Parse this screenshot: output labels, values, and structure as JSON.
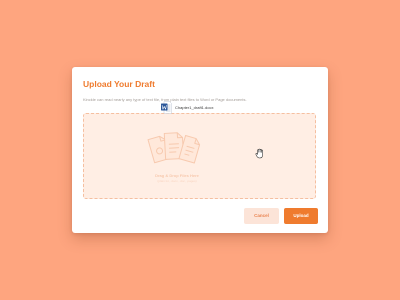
{
  "dialog": {
    "title": "Upload Your Draft",
    "subtitle": "Kinckle can read nearly any type of text file, from plain text files to Word or Page documents."
  },
  "dropzone": {
    "main_text": "Drag & Drop Files Here",
    "hint_text": "(plain txt, .docx, .doc, .pages)"
  },
  "dragged_file": {
    "name": "Chapter1_draft1.docx",
    "icon": "word-doc-icon"
  },
  "buttons": {
    "cancel_label": "Cancel",
    "upload_label": "Upload"
  },
  "colors": {
    "background": "#FEA57F",
    "accent": "#EF7B2E",
    "dropzone_fill": "#FFEEE4",
    "word_blue": "#2B579A"
  }
}
